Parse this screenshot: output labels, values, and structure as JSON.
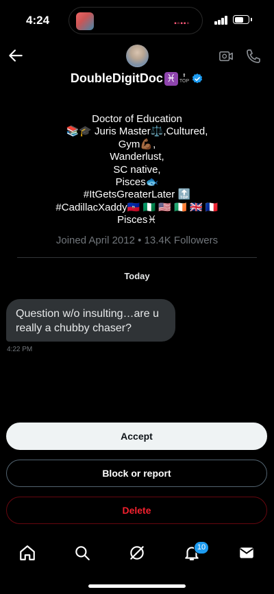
{
  "status": {
    "time": "4:24"
  },
  "header": {
    "display_name": "DoubleDigitDoc",
    "name_emoji": "♓",
    "top_icon": "TOP",
    "icons": [
      "back-arrow-icon",
      "video-call-icon",
      "phone-call-icon",
      "verified-icon"
    ]
  },
  "bio": {
    "lines": [
      "Doctor of Education",
      "📚🎓 Juris Master⚖️,Cultured,",
      "Gym💪🏾,",
      "Wanderlust,",
      "SC native,",
      "Pisces🐟",
      "#ItGetsGreaterLater 🔝",
      "#CadillacXaddy🇭🇹 🇳🇬 🇺🇸 🇮🇪 🇬🇧 🇫🇷",
      "Pisces♓"
    ],
    "joined": "Joined April 2012 • 13.4K Followers"
  },
  "conversation": {
    "date_separator": "Today",
    "messages": [
      {
        "text": "Question w/o insulting…are u really a chubby chaser?",
        "time": "4:22 PM"
      }
    ]
  },
  "actions": {
    "accept": "Accept",
    "block": "Block or report",
    "delete": "Delete"
  },
  "tabbar": {
    "items": [
      "home-icon",
      "search-icon",
      "grok-icon",
      "notifications-icon",
      "messages-icon"
    ],
    "notification_count": "10"
  },
  "colors": {
    "background": "#000000",
    "accent": "#1d9bf0",
    "danger": "#f4212e",
    "bubble": "#2f3336",
    "muted": "#71767b"
  }
}
